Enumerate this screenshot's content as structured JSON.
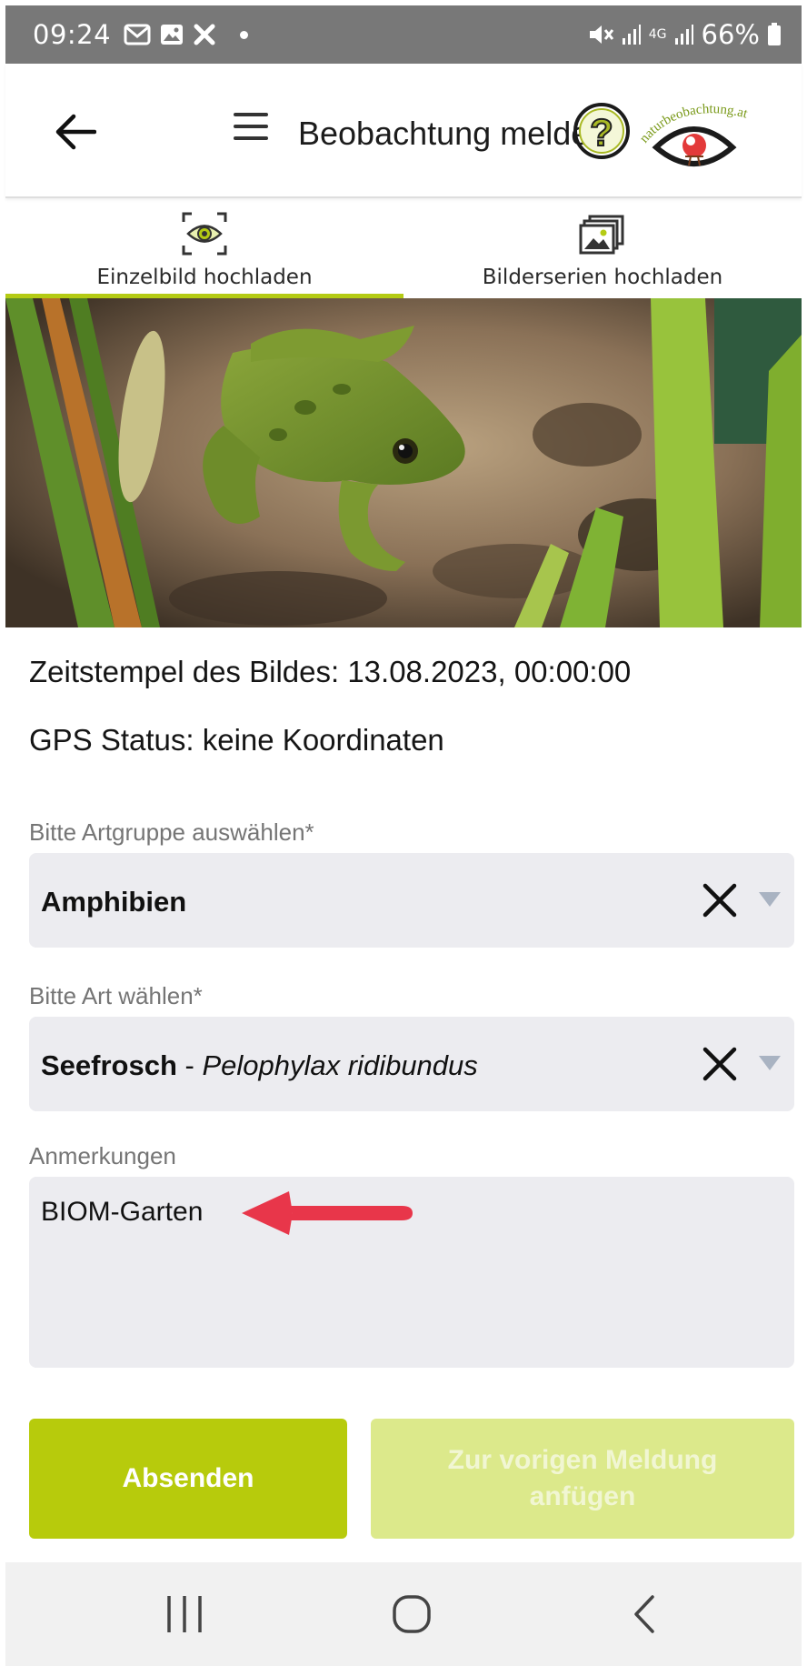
{
  "status_bar": {
    "time": "09:24",
    "battery": "66%",
    "network": "4G"
  },
  "header": {
    "title": "Beobachtung melden",
    "logo_text": "naturbeobachtung.at"
  },
  "tabs": [
    {
      "label": "Einzelbild hochladen",
      "icon": "eye-scan-icon",
      "active": true
    },
    {
      "label": "Bilderserien hochladen",
      "icon": "image-stack-icon",
      "active": false
    }
  ],
  "photo": {
    "subject": "frog-photo"
  },
  "info": {
    "timestamp": "Zeitstempel des Bildes: 13.08.2023, 00:00:00",
    "gps": "GPS Status: keine Koordinaten"
  },
  "group_select": {
    "label": "Bitte Artgruppe auswählen*",
    "value": "Amphibien"
  },
  "species_select": {
    "label": "Bitte Art wählen*",
    "common_name": "Seefrosch",
    "separator": " - ",
    "scientific_name": "Pelophylax ridibundus"
  },
  "notes": {
    "label": "Anmerkungen",
    "value": "BIOM-Garten"
  },
  "buttons": {
    "send": "Absenden",
    "append_line1": "Zur vorigen Meldung",
    "append_line2": "anfügen"
  },
  "colors": {
    "accent": "#b7cb0c",
    "accent_disabled": "#dce98b",
    "annotation_arrow": "#e8364a"
  }
}
